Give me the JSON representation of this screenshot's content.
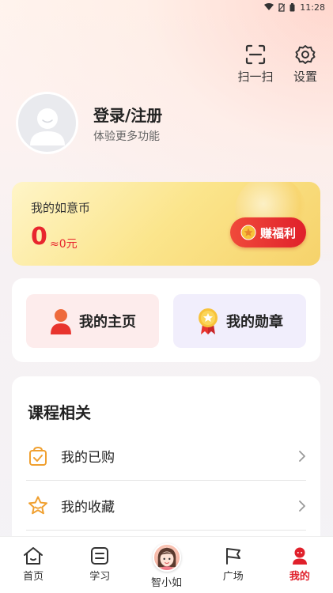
{
  "status_bar": {
    "time": "11:28"
  },
  "header": {
    "scan_label": "扫一扫",
    "settings_label": "设置"
  },
  "user": {
    "login_title": "登录/注册",
    "login_subtitle": "体验更多功能"
  },
  "coins": {
    "title": "我的如意币",
    "value": "0",
    "approx": "≈0元",
    "earn_button": "赚福利"
  },
  "profile_tiles": {
    "homepage": "我的主页",
    "badges": "我的勋章"
  },
  "courses": {
    "title": "课程相关",
    "items": [
      {
        "label": "我的已购",
        "icon": "bag-check-icon"
      },
      {
        "label": "我的收藏",
        "icon": "star-outline-icon"
      }
    ]
  },
  "tabs": [
    {
      "label": "首页",
      "icon": "home-icon"
    },
    {
      "label": "学习",
      "icon": "study-icon"
    },
    {
      "label": "智小如",
      "icon": "mascot-avatar"
    },
    {
      "label": "广场",
      "icon": "flag-icon"
    },
    {
      "label": "我的",
      "icon": "person-icon",
      "active": true
    }
  ],
  "colors": {
    "accent_red": "#e0202b",
    "coin_card_yellow": "#fbe58c",
    "homepage_tile": "#fdecec",
    "badges_tile": "#f1eefc",
    "item_icon_orange": "#f0a030"
  }
}
